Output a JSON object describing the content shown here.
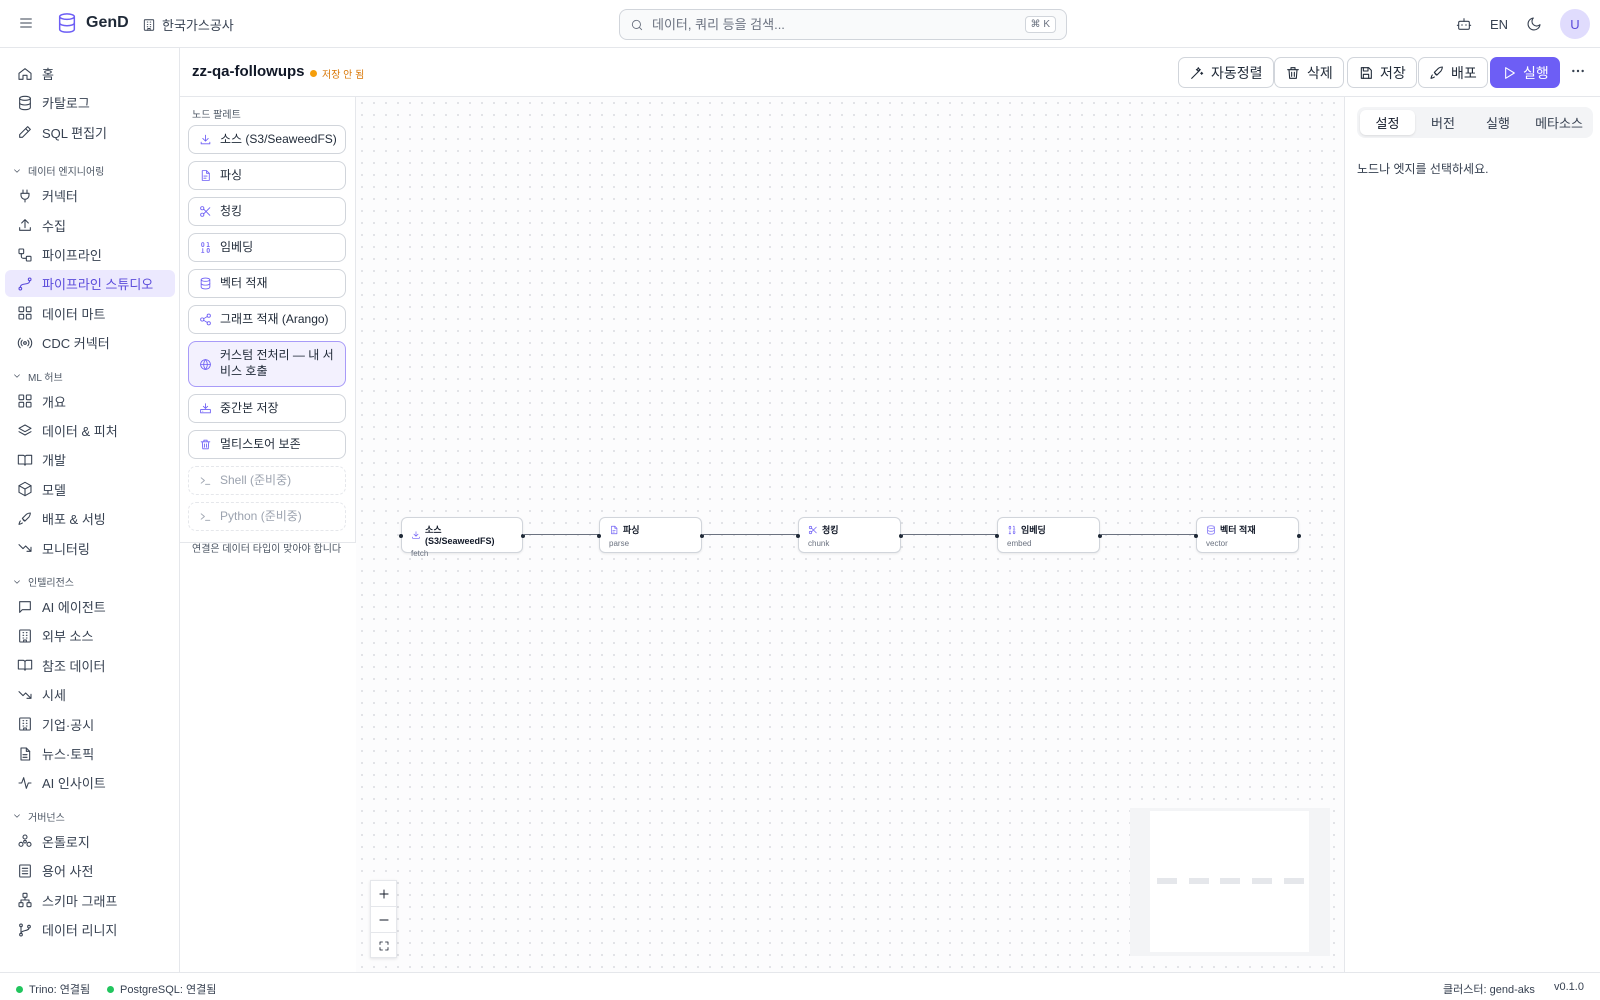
{
  "colors": {
    "accent": "#6d5ef5",
    "unsaved": "#f59e0b",
    "connected": "#22c55e"
  },
  "app": {
    "name": "GenD",
    "org": "한국가스공사"
  },
  "search": {
    "placeholder": "데이터, 쿼리 등을 검색...",
    "shortcut": "⌘ K"
  },
  "topbar": {
    "language": "EN",
    "avatar": "U"
  },
  "sidebar": {
    "top_items": [
      {
        "label": "홈",
        "icon": "home-icon"
      },
      {
        "label": "카탈로그",
        "icon": "database-icon"
      },
      {
        "label": "SQL 편집기",
        "icon": "edit-icon"
      }
    ],
    "sections": [
      {
        "title": "데이터 엔지니어링",
        "items": [
          {
            "label": "커넥터",
            "icon": "plug-icon"
          },
          {
            "label": "수집",
            "icon": "upload-icon"
          },
          {
            "label": "파이프라인",
            "icon": "workflow-icon"
          },
          {
            "label": "파이프라인 스튜디오",
            "icon": "spline-icon",
            "active": true
          },
          {
            "label": "데이터 마트",
            "icon": "grid-icon"
          },
          {
            "label": "CDC 커넥터",
            "icon": "radio-icon"
          }
        ]
      },
      {
        "title": "ML 허브",
        "items": [
          {
            "label": "개요",
            "icon": "grid-icon"
          },
          {
            "label": "데이터 & 피처",
            "icon": "layers-icon"
          },
          {
            "label": "개발",
            "icon": "book-icon"
          },
          {
            "label": "모델",
            "icon": "box-icon"
          },
          {
            "label": "배포 & 서빙",
            "icon": "rocket-icon"
          },
          {
            "label": "모니터링",
            "icon": "trend-down-icon"
          }
        ]
      },
      {
        "title": "인텔리전스",
        "items": [
          {
            "label": "AI 에이전트",
            "icon": "message-icon"
          },
          {
            "label": "외부 소스",
            "icon": "building-icon"
          },
          {
            "label": "참조 데이터",
            "icon": "book-icon"
          },
          {
            "label": "시세",
            "icon": "trend-down-icon"
          },
          {
            "label": "기업·공시",
            "icon": "building-icon"
          },
          {
            "label": "뉴스·토픽",
            "icon": "file-icon"
          },
          {
            "label": "AI 인사이트",
            "icon": "activity-icon"
          }
        ]
      },
      {
        "title": "거버넌스",
        "items": [
          {
            "label": "온톨로지",
            "icon": "molecule-icon"
          },
          {
            "label": "용어 사전",
            "icon": "list-icon"
          },
          {
            "label": "스키마 그래프",
            "icon": "network-icon"
          },
          {
            "label": "데이터 리니지",
            "icon": "branch-icon"
          }
        ]
      }
    ]
  },
  "header": {
    "title": "zz-qa-followups",
    "status": "저장 안 됨",
    "buttons": {
      "autolayout": "자동정렬",
      "delete": "삭제",
      "save": "저장",
      "deploy": "배포",
      "run": "실행"
    }
  },
  "palette": {
    "title": "노드 팔레트",
    "items": [
      {
        "label": "소스 (S3/SeaweedFS)",
        "icon": "download-icon"
      },
      {
        "label": "파싱",
        "icon": "file-text-icon"
      },
      {
        "label": "청킹",
        "icon": "scissors-icon"
      },
      {
        "label": "임베딩",
        "icon": "binary-icon"
      },
      {
        "label": "벡터 적재",
        "icon": "database-icon"
      },
      {
        "label": "그래프 적재 (Arango)",
        "icon": "share-icon"
      },
      {
        "label": "커스텀 전처리 — 내 서비스 호출",
        "icon": "globe-icon",
        "highlight": true
      },
      {
        "label": "중간본 저장",
        "icon": "hard-drive-icon"
      },
      {
        "label": "멀티스토어 보존",
        "icon": "trash-icon"
      },
      {
        "label": "Shell (준비중)",
        "icon": "terminal-icon",
        "disabled": true
      },
      {
        "label": "Python (준비중)",
        "icon": "terminal-icon",
        "disabled": true
      }
    ],
    "hint": "연결은 데이터 타입이 맞아야 합니다"
  },
  "flow": {
    "nodes": [
      {
        "label": "소스 (S3/SeaweedFS)",
        "sub": "fetch",
        "icon": "download-icon"
      },
      {
        "label": "파싱",
        "sub": "parse",
        "icon": "file-text-icon"
      },
      {
        "label": "청킹",
        "sub": "chunk",
        "icon": "scissors-icon"
      },
      {
        "label": "임베딩",
        "sub": "embed",
        "icon": "binary-icon"
      },
      {
        "label": "벡터 적재",
        "sub": "vector",
        "icon": "database-icon"
      }
    ]
  },
  "right_panel": {
    "tabs": [
      "설정",
      "버전",
      "실행",
      "메타소스"
    ],
    "active_tab": "설정",
    "empty_message": "노드나 엣지를 선택하세요."
  },
  "statusbar": {
    "trino": "Trino: 연결됨",
    "postgres": "PostgreSQL: 연결됨",
    "cluster": "클러스터: gend-aks",
    "version": "v0.1.0"
  }
}
